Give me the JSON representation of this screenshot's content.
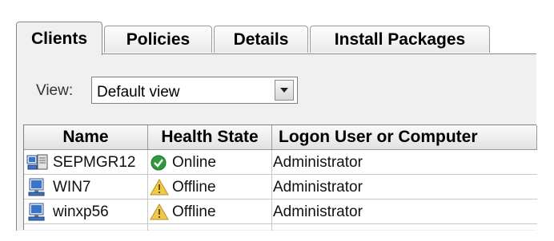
{
  "tabs": [
    {
      "label": "Clients",
      "active": true
    },
    {
      "label": "Policies",
      "active": false
    },
    {
      "label": "Details",
      "active": false
    },
    {
      "label": "Install Packages",
      "active": false
    }
  ],
  "view": {
    "label": "View:",
    "selected": "Default view"
  },
  "table": {
    "columns": [
      "Name",
      "Health State",
      "Logon User or Computer"
    ],
    "rows": [
      {
        "name": "SEPMGR12",
        "health": "Online",
        "health_icon": "check-icon",
        "user": "Administrator",
        "icon": "server-icon"
      },
      {
        "name": "WIN7",
        "health": "Offline",
        "health_icon": "warning-icon",
        "user": "Administrator",
        "icon": "computer-icon"
      },
      {
        "name": "winxp56",
        "health": "Offline",
        "health_icon": "warning-icon",
        "user": "Administrator",
        "icon": "computer-icon"
      }
    ]
  },
  "colors": {
    "online": "#2e9a3a",
    "warning": "#f2c84b",
    "panel": "#f0f0f0"
  }
}
